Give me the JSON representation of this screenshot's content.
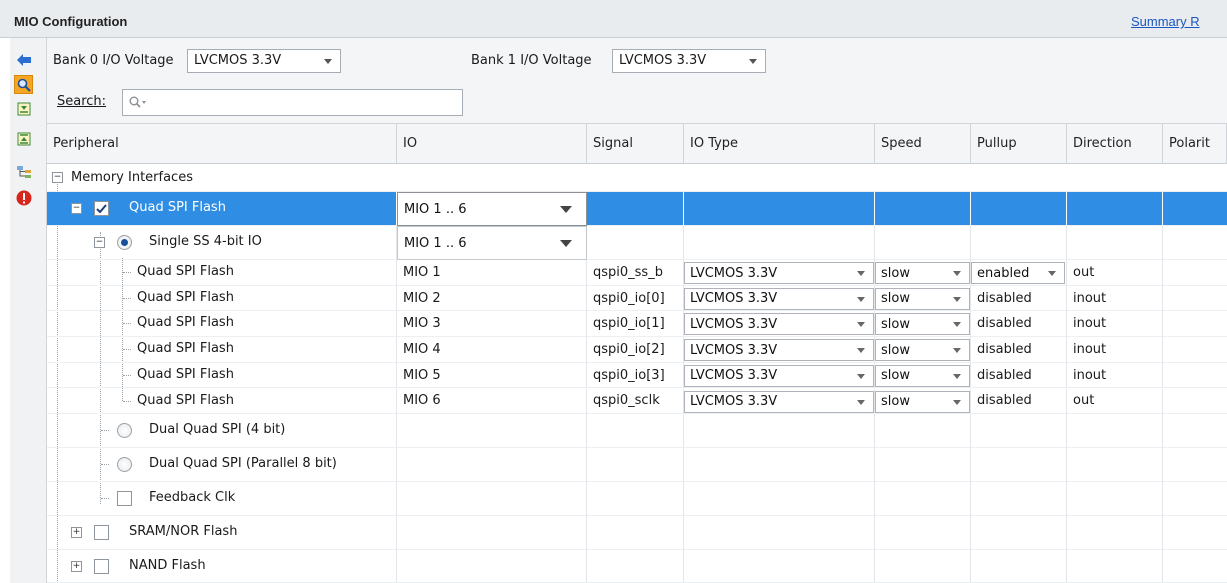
{
  "panel": {
    "title": "MIO Configuration",
    "summary_link": "Summary R"
  },
  "bank0": {
    "label": "Bank 0 I/O Voltage",
    "value": "LVCMOS 3.3V"
  },
  "bank1": {
    "label": "Bank 1 I/O Voltage",
    "value": "LVCMOS 3.3V"
  },
  "search": {
    "label": "Search:",
    "icon": "search-icon"
  },
  "columns": [
    "Peripheral",
    "IO",
    "Signal",
    "IO Type",
    "Speed",
    "Pullup",
    "Direction",
    "Polarit"
  ],
  "tree": {
    "memory_interfaces": "Memory Interfaces",
    "quad_spi": {
      "label": "Quad SPI Flash",
      "io": "MIO 1 .. 6"
    },
    "single_ss": {
      "label": "Single SS 4-bit IO",
      "io": "MIO 1 .. 6"
    },
    "rows": [
      {
        "peripheral": "Quad SPI Flash",
        "io": "MIO 1",
        "signal": "qspi0_ss_b",
        "io_type": "LVCMOS 3.3V",
        "speed": "slow",
        "pullup": "enabled",
        "direction": "out"
      },
      {
        "peripheral": "Quad SPI Flash",
        "io": "MIO 2",
        "signal": "qspi0_io[0]",
        "io_type": "LVCMOS 3.3V",
        "speed": "slow",
        "pullup": "disabled",
        "direction": "inout"
      },
      {
        "peripheral": "Quad SPI Flash",
        "io": "MIO 3",
        "signal": "qspi0_io[1]",
        "io_type": "LVCMOS 3.3V",
        "speed": "slow",
        "pullup": "disabled",
        "direction": "inout"
      },
      {
        "peripheral": "Quad SPI Flash",
        "io": "MIO 4",
        "signal": "qspi0_io[2]",
        "io_type": "LVCMOS 3.3V",
        "speed": "slow",
        "pullup": "disabled",
        "direction": "inout"
      },
      {
        "peripheral": "Quad SPI Flash",
        "io": "MIO 5",
        "signal": "qspi0_io[3]",
        "io_type": "LVCMOS 3.3V",
        "speed": "slow",
        "pullup": "disabled",
        "direction": "inout"
      },
      {
        "peripheral": "Quad SPI Flash",
        "io": "MIO 6",
        "signal": "qspi0_sclk",
        "io_type": "LVCMOS 3.3V",
        "speed": "slow",
        "pullup": "disabled",
        "direction": "out"
      }
    ],
    "dual_quad": "Dual Quad SPI (4 bit)",
    "dual_quad_parallel": "Dual Quad SPI (Parallel 8 bit)",
    "feedback_clk": "Feedback Clk",
    "sram_nor": "SRAM/NOR Flash",
    "nand": "NAND Flash"
  },
  "colors": {
    "selection": "#2f8ee3",
    "link": "#1a56c4",
    "toolbar_active": "#f6a623",
    "error": "#d9261c"
  }
}
